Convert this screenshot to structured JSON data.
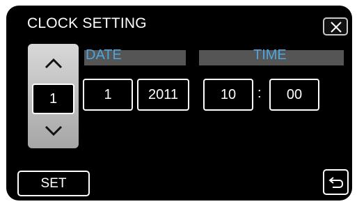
{
  "header": {
    "title": "CLOCK SETTING",
    "close_icon": "close-icon"
  },
  "stepper": {
    "up_icon": "chevron-up-icon",
    "down_icon": "chevron-down-icon",
    "value": "1"
  },
  "date": {
    "label": "DATE",
    "day": "1",
    "year": "2011"
  },
  "time": {
    "label": "TIME",
    "hour": "10",
    "separator": ":",
    "minute": "00"
  },
  "footer": {
    "set_label": "SET",
    "back_icon": "return-arrow-icon"
  },
  "colors": {
    "background": "#000000",
    "label_blue": "#4ea6e0",
    "section_bar": "#555555"
  }
}
